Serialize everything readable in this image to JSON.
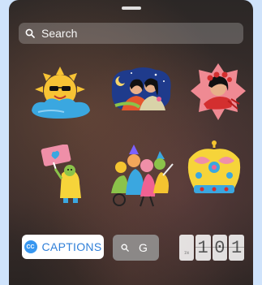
{
  "search": {
    "placeholder": "Search"
  },
  "stickers": [
    {
      "name": "sun-girl-sticker"
    },
    {
      "name": "two-girls-night-sticker"
    },
    {
      "name": "woman-flowers-sticker"
    },
    {
      "name": "heart-sign-character-sticker"
    },
    {
      "name": "crowd-dancing-sticker"
    },
    {
      "name": "crown-sticker"
    }
  ],
  "captions": {
    "icon_text": "CC",
    "label": "CAPTIONS"
  },
  "search_sticker": {
    "query": "G"
  },
  "counter": {
    "prefix": "IN",
    "digits": [
      "1",
      "0",
      "1"
    ]
  }
}
